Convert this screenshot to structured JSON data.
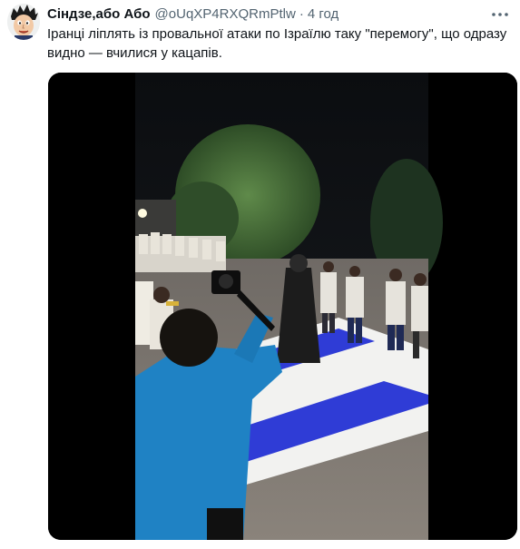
{
  "tweet": {
    "display_name": "Сіндзе,або Або",
    "handle": "@oUqXP4RXQRmPtlw",
    "separator": "·",
    "time": "4 год",
    "text": "Іранці ліплять із провальної атаки по Ізраїлю таку \"перемогу\", що одразу видно — вчилися у кацапів.",
    "avatar_icon": "cartoon-face-avatar-icon",
    "more_icon": "more-options-icon"
  },
  "media": {
    "kind": "video-still",
    "icon": "video-thumbnail"
  },
  "colors": {
    "name": "#0f1419",
    "secondary": "#536471",
    "flag_blue": "#2f3cd6"
  }
}
